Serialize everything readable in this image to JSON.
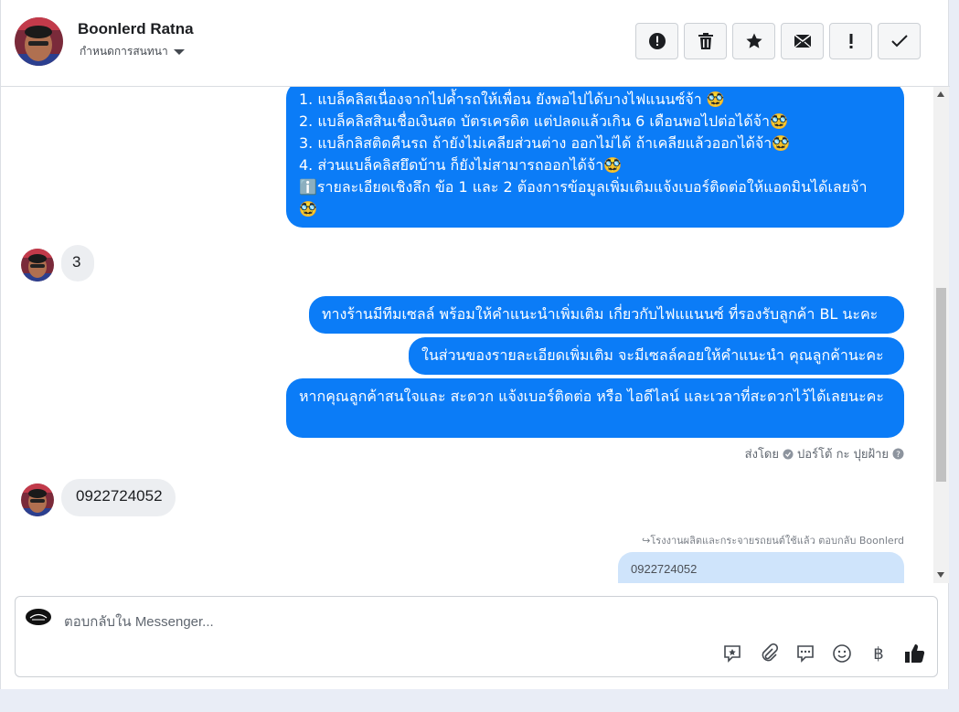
{
  "header": {
    "name": "Boonlerd Ratna",
    "subtitle": "กำหนดการสนทนา",
    "actions": [
      "report-icon",
      "trash-icon",
      "star-icon",
      "envelope-icon",
      "exclamation-icon",
      "check-icon"
    ]
  },
  "messages": {
    "block1": {
      "line1": "1. แบล็คลิสเนื่องจากไปค้ำรถให้เพื่อน ยังพอไปได้บางไฟแนนซ์จ้า 🥸",
      "line2": "2. แบล็คลิสสินเชื่อเงินสด บัตรเครดิต แต่ปลดแล้วเกิน 6 เดือนพอไปต่อได้จ้า🥸",
      "line3": "3. แบล็กลิสติดคืนรถ ถ้ายังไม่เคลียส่วนต่าง ออกไม่ได้ ถ้าเคลียแล้วออกได้จ้า🥸",
      "line4": "4. ส่วนแบล็คลิสยึดบ้าน ก็ยังไม่สามารถออกได้จ้า🥸",
      "line5": "ℹ️รายละเอียดเชิงลึก ข้อ 1 และ 2 ต้องการข้อมูลเพิ่มเติมแจ้งเบอร์ติดต่อให้แอดมินได้เลยจ้า",
      "line6": "🥸"
    },
    "in1": "3",
    "out2": "ทางร้านมีทีมเซลล์ พร้อมให้คำแนะนำเพิ่มเติม เกี่ยวกับไฟแแนนซ์ ที่รองรับลูกค้า BL นะคะ",
    "out3": "ในส่วนของรายละเอียดเพิ่มเติม จะมีเซลล์คอยให้คำแนะนำ คุณลูกค้านะคะ",
    "out4": "หากคุณลูกค้าสนใจและ สะดวก แจ้งเบอร์ติดต่อ หรือ ไอดีไลน์ และเวลาที่สะดวกไว้ได้เลยนะคะ",
    "sent_by": "ส่งโดย",
    "sender": "ปอร์โต้ กะ ปุยฝ้าย",
    "in2": "0922724052",
    "reply_meta": "↪โรงงานผลิตและกระจายรถยนต์ใช้แล้ว ตอบกลับ Boonlerd",
    "quoted": "0922724052"
  },
  "composer": {
    "placeholder": "ตอบกลับใน Messenger...",
    "tools": [
      "saved-reply-icon",
      "attachment-icon",
      "chat-icon",
      "emoji-icon",
      "baht-icon",
      "thumbs-up-icon"
    ],
    "baht_symbol": "฿"
  },
  "colors": {
    "outgoing": "#0b7cf7",
    "incoming": "#eceef1",
    "quote": "#cfe4fb"
  }
}
